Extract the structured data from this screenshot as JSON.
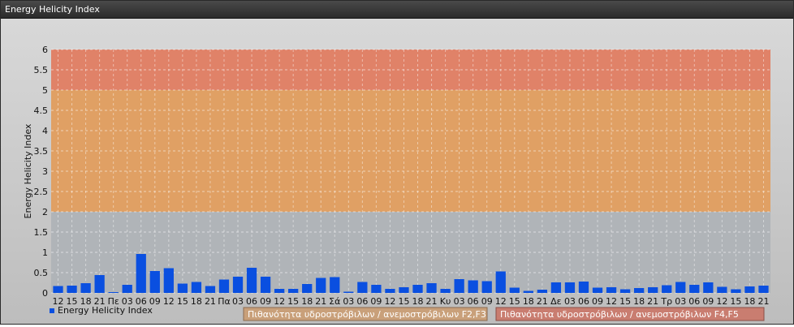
{
  "window": {
    "title": "Energy Helicity Index"
  },
  "colors": {
    "bar": "#0a4fe0",
    "band_low": "#b0b4b8",
    "band_mid": "#e0a064",
    "band_high": "#e08268",
    "grid": "#ffffff",
    "legend_band1_bg": "#c9a07a",
    "legend_band2_bg": "#c97d70"
  },
  "legend": {
    "series_label": "Energy Helicity Index",
    "band1_label": "Πιθανότητα υδροστρόβιλων / ανεμοστρόβιλων F2,F3",
    "band2_label": "Πιθανότητα υδροστρόβιλων / ανεμοστρόβιλων F4,F5"
  },
  "chart_data": {
    "type": "bar",
    "title": "",
    "xlabel": "",
    "ylabel": "Energy Helicity Index",
    "ylim": [
      0,
      6
    ],
    "yticks": [
      "0",
      "0.5",
      "1",
      "1.5",
      "2",
      "2.5",
      "3",
      "3.5",
      "4",
      "4.5",
      "5",
      "5.5",
      "6"
    ],
    "grid": true,
    "legend_position": "bottom-left",
    "bands": [
      {
        "from": 0,
        "to": 2,
        "label": ""
      },
      {
        "from": 2,
        "to": 5,
        "label": "Πιθανότητα υδροστρόβιλων / ανεμοστρόβιλων F2,F3"
      },
      {
        "from": 5,
        "to": 6,
        "label": "Πιθανότητα υδροστρόβιλων / ανεμοστρόβιλων F4,F5"
      }
    ],
    "categories": [
      "12",
      "15",
      "18",
      "21",
      "Πε",
      "03",
      "06",
      "09",
      "12",
      "15",
      "18",
      "21",
      "Πα",
      "03",
      "06",
      "09",
      "12",
      "15",
      "18",
      "21",
      "Σά",
      "03",
      "06",
      "09",
      "12",
      "15",
      "18",
      "21",
      "Κυ",
      "03",
      "06",
      "09",
      "12",
      "15",
      "18",
      "21",
      "Δε",
      "03",
      "06",
      "09",
      "12",
      "15",
      "18",
      "21",
      "Τρ",
      "03",
      "06",
      "09",
      "12",
      "15",
      "18",
      "21"
    ],
    "series": [
      {
        "name": "Energy Helicity Index",
        "values": [
          0.17,
          0.18,
          0.24,
          0.44,
          0.02,
          0.2,
          0.96,
          0.54,
          0.61,
          0.23,
          0.27,
          0.17,
          0.33,
          0.4,
          0.62,
          0.4,
          0.1,
          0.1,
          0.22,
          0.37,
          0.39,
          0.03,
          0.27,
          0.2,
          0.1,
          0.14,
          0.2,
          0.24,
          0.1,
          0.34,
          0.31,
          0.29,
          0.53,
          0.13,
          0.05,
          0.08,
          0.26,
          0.26,
          0.28,
          0.13,
          0.14,
          0.09,
          0.12,
          0.14,
          0.19,
          0.27,
          0.2,
          0.26,
          0.15,
          0.09,
          0.16,
          0.18
        ]
      }
    ]
  }
}
